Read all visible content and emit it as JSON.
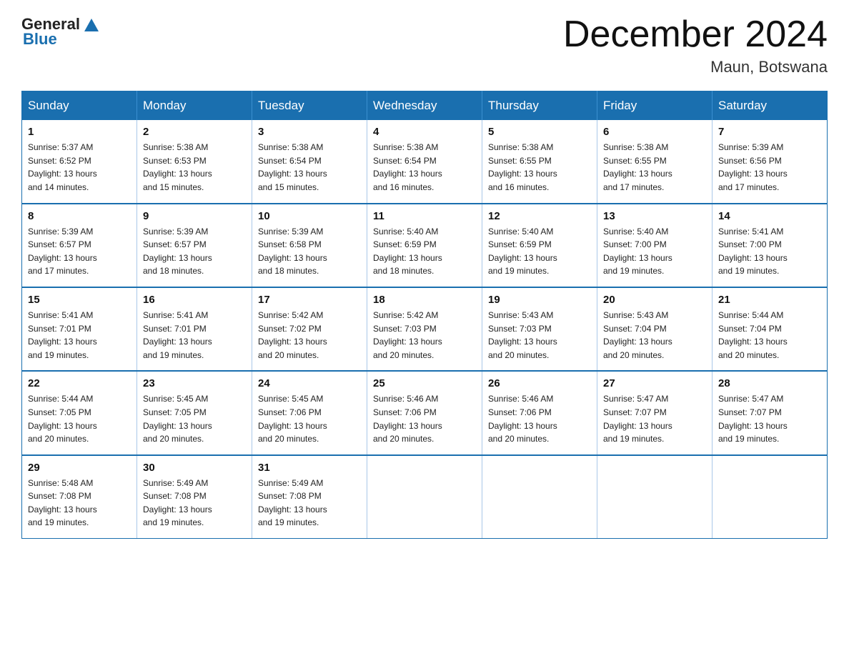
{
  "logo": {
    "text_general": "General",
    "text_blue": "Blue"
  },
  "header": {
    "month": "December 2024",
    "location": "Maun, Botswana"
  },
  "weekdays": [
    "Sunday",
    "Monday",
    "Tuesday",
    "Wednesday",
    "Thursday",
    "Friday",
    "Saturday"
  ],
  "weeks": [
    [
      {
        "day": "1",
        "sunrise": "5:37 AM",
        "sunset": "6:52 PM",
        "daylight": "13 hours and 14 minutes."
      },
      {
        "day": "2",
        "sunrise": "5:38 AM",
        "sunset": "6:53 PM",
        "daylight": "13 hours and 15 minutes."
      },
      {
        "day": "3",
        "sunrise": "5:38 AM",
        "sunset": "6:54 PM",
        "daylight": "13 hours and 15 minutes."
      },
      {
        "day": "4",
        "sunrise": "5:38 AM",
        "sunset": "6:54 PM",
        "daylight": "13 hours and 16 minutes."
      },
      {
        "day": "5",
        "sunrise": "5:38 AM",
        "sunset": "6:55 PM",
        "daylight": "13 hours and 16 minutes."
      },
      {
        "day": "6",
        "sunrise": "5:38 AM",
        "sunset": "6:55 PM",
        "daylight": "13 hours and 17 minutes."
      },
      {
        "day": "7",
        "sunrise": "5:39 AM",
        "sunset": "6:56 PM",
        "daylight": "13 hours and 17 minutes."
      }
    ],
    [
      {
        "day": "8",
        "sunrise": "5:39 AM",
        "sunset": "6:57 PM",
        "daylight": "13 hours and 17 minutes."
      },
      {
        "day": "9",
        "sunrise": "5:39 AM",
        "sunset": "6:57 PM",
        "daylight": "13 hours and 18 minutes."
      },
      {
        "day": "10",
        "sunrise": "5:39 AM",
        "sunset": "6:58 PM",
        "daylight": "13 hours and 18 minutes."
      },
      {
        "day": "11",
        "sunrise": "5:40 AM",
        "sunset": "6:59 PM",
        "daylight": "13 hours and 18 minutes."
      },
      {
        "day": "12",
        "sunrise": "5:40 AM",
        "sunset": "6:59 PM",
        "daylight": "13 hours and 19 minutes."
      },
      {
        "day": "13",
        "sunrise": "5:40 AM",
        "sunset": "7:00 PM",
        "daylight": "13 hours and 19 minutes."
      },
      {
        "day": "14",
        "sunrise": "5:41 AM",
        "sunset": "7:00 PM",
        "daylight": "13 hours and 19 minutes."
      }
    ],
    [
      {
        "day": "15",
        "sunrise": "5:41 AM",
        "sunset": "7:01 PM",
        "daylight": "13 hours and 19 minutes."
      },
      {
        "day": "16",
        "sunrise": "5:41 AM",
        "sunset": "7:01 PM",
        "daylight": "13 hours and 19 minutes."
      },
      {
        "day": "17",
        "sunrise": "5:42 AM",
        "sunset": "7:02 PM",
        "daylight": "13 hours and 20 minutes."
      },
      {
        "day": "18",
        "sunrise": "5:42 AM",
        "sunset": "7:03 PM",
        "daylight": "13 hours and 20 minutes."
      },
      {
        "day": "19",
        "sunrise": "5:43 AM",
        "sunset": "7:03 PM",
        "daylight": "13 hours and 20 minutes."
      },
      {
        "day": "20",
        "sunrise": "5:43 AM",
        "sunset": "7:04 PM",
        "daylight": "13 hours and 20 minutes."
      },
      {
        "day": "21",
        "sunrise": "5:44 AM",
        "sunset": "7:04 PM",
        "daylight": "13 hours and 20 minutes."
      }
    ],
    [
      {
        "day": "22",
        "sunrise": "5:44 AM",
        "sunset": "7:05 PM",
        "daylight": "13 hours and 20 minutes."
      },
      {
        "day": "23",
        "sunrise": "5:45 AM",
        "sunset": "7:05 PM",
        "daylight": "13 hours and 20 minutes."
      },
      {
        "day": "24",
        "sunrise": "5:45 AM",
        "sunset": "7:06 PM",
        "daylight": "13 hours and 20 minutes."
      },
      {
        "day": "25",
        "sunrise": "5:46 AM",
        "sunset": "7:06 PM",
        "daylight": "13 hours and 20 minutes."
      },
      {
        "day": "26",
        "sunrise": "5:46 AM",
        "sunset": "7:06 PM",
        "daylight": "13 hours and 20 minutes."
      },
      {
        "day": "27",
        "sunrise": "5:47 AM",
        "sunset": "7:07 PM",
        "daylight": "13 hours and 19 minutes."
      },
      {
        "day": "28",
        "sunrise": "5:47 AM",
        "sunset": "7:07 PM",
        "daylight": "13 hours and 19 minutes."
      }
    ],
    [
      {
        "day": "29",
        "sunrise": "5:48 AM",
        "sunset": "7:08 PM",
        "daylight": "13 hours and 19 minutes."
      },
      {
        "day": "30",
        "sunrise": "5:49 AM",
        "sunset": "7:08 PM",
        "daylight": "13 hours and 19 minutes."
      },
      {
        "day": "31",
        "sunrise": "5:49 AM",
        "sunset": "7:08 PM",
        "daylight": "13 hours and 19 minutes."
      },
      null,
      null,
      null,
      null
    ]
  ],
  "labels": {
    "sunrise": "Sunrise:",
    "sunset": "Sunset:",
    "daylight": "Daylight:"
  }
}
